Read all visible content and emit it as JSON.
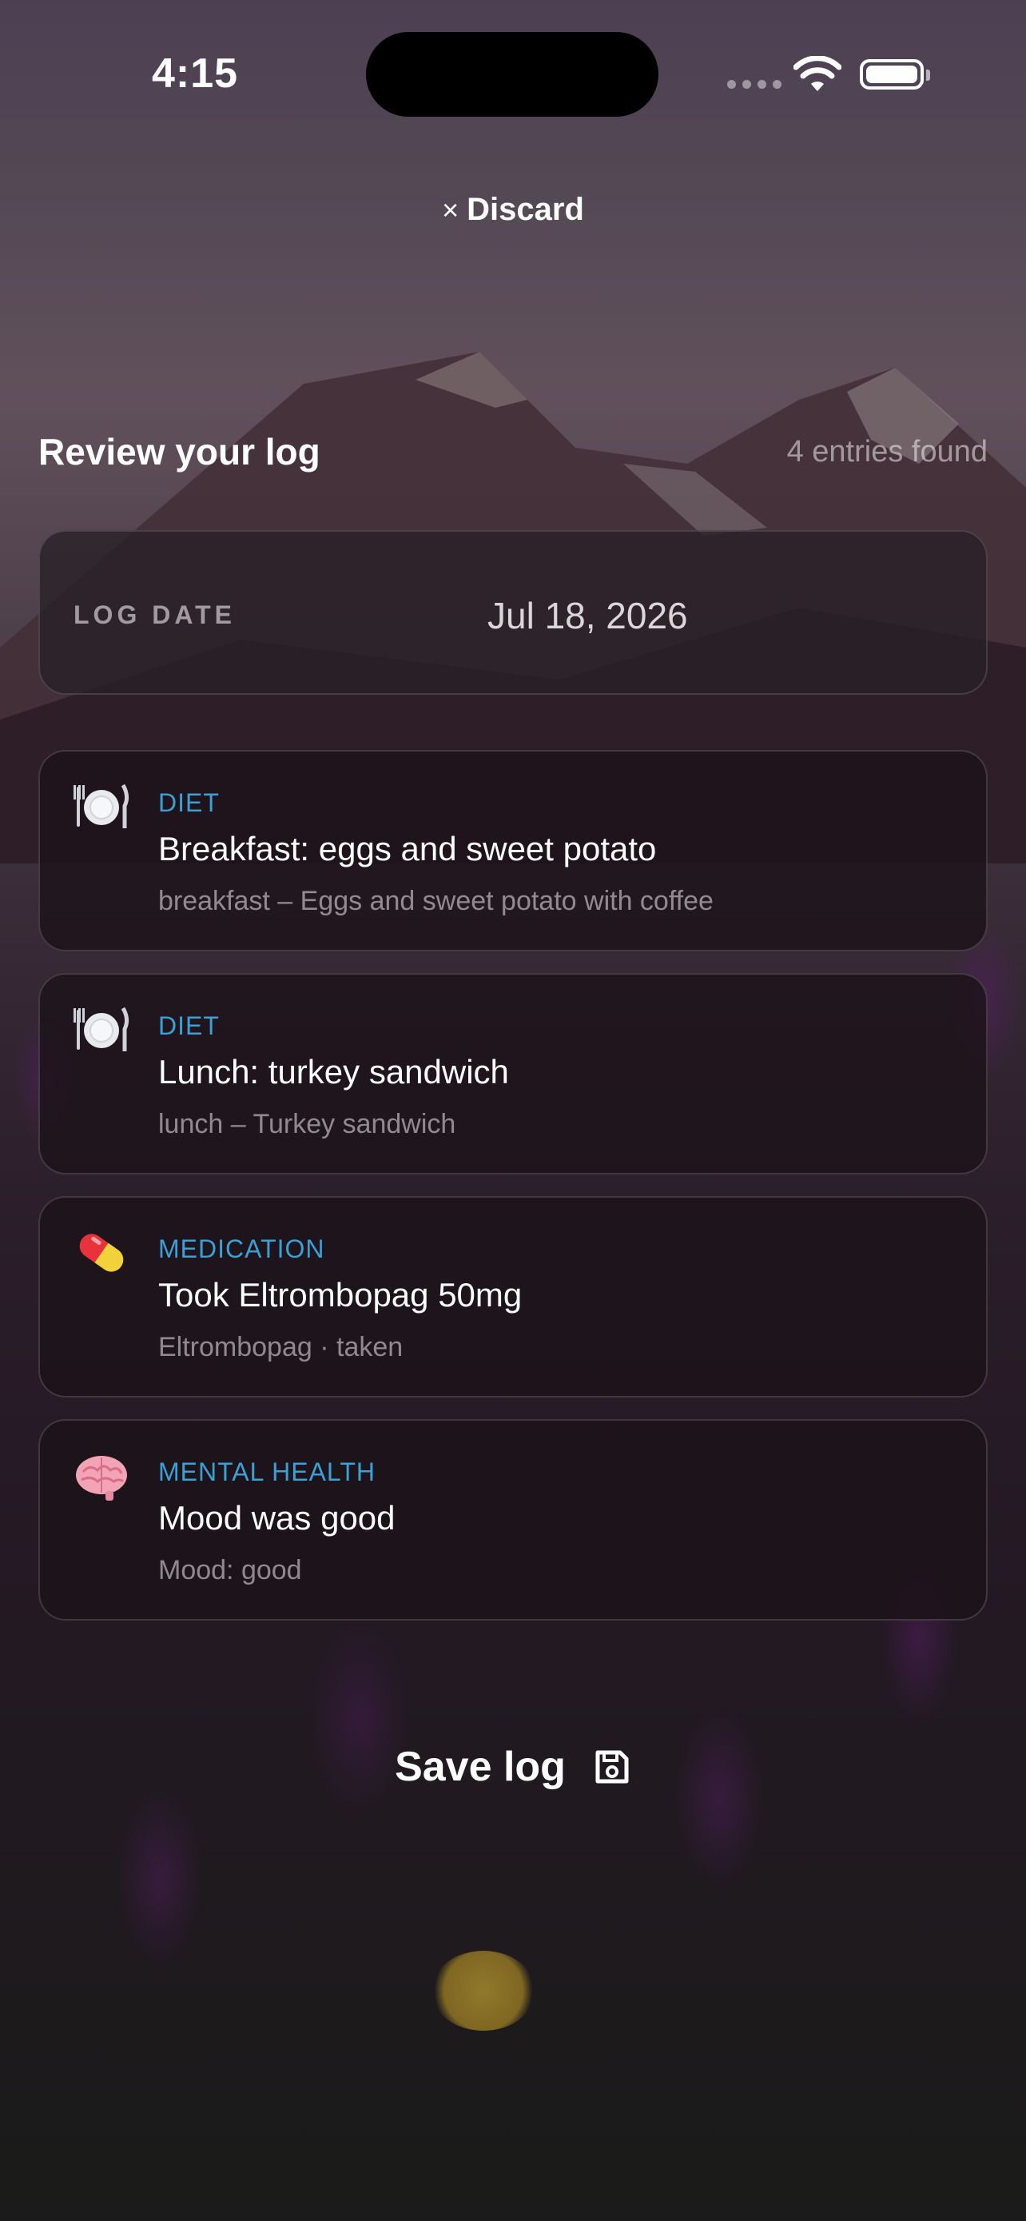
{
  "status_bar": {
    "time": "4:15"
  },
  "header": {
    "discard_icon": "×",
    "discard_label": "Discard"
  },
  "review": {
    "title": "Review your log",
    "entries_found": "4 entries found"
  },
  "log_date": {
    "label": "LOG DATE",
    "value": "Jul 18, 2026"
  },
  "entries": [
    {
      "icon": "plate-cutlery-icon",
      "category": "DIET",
      "title": "Breakfast: eggs and sweet potato",
      "detail": "breakfast – Eggs and sweet potato with coffee"
    },
    {
      "icon": "plate-cutlery-icon",
      "category": "DIET",
      "title": "Lunch: turkey sandwich",
      "detail": "lunch – Turkey sandwich"
    },
    {
      "icon": "pill-icon",
      "category": "MEDICATION",
      "title": "Took Eltrombopag 50mg",
      "detail": "Eltrombopag · taken"
    },
    {
      "icon": "brain-icon",
      "category": "MENTAL HEALTH",
      "title": "Mood was good",
      "detail": "Mood: good"
    }
  ],
  "footer": {
    "save_label": "Save log",
    "save_icon": "floppy-disk-icon"
  },
  "colors": {
    "category_accent": "#3aa0d6"
  }
}
